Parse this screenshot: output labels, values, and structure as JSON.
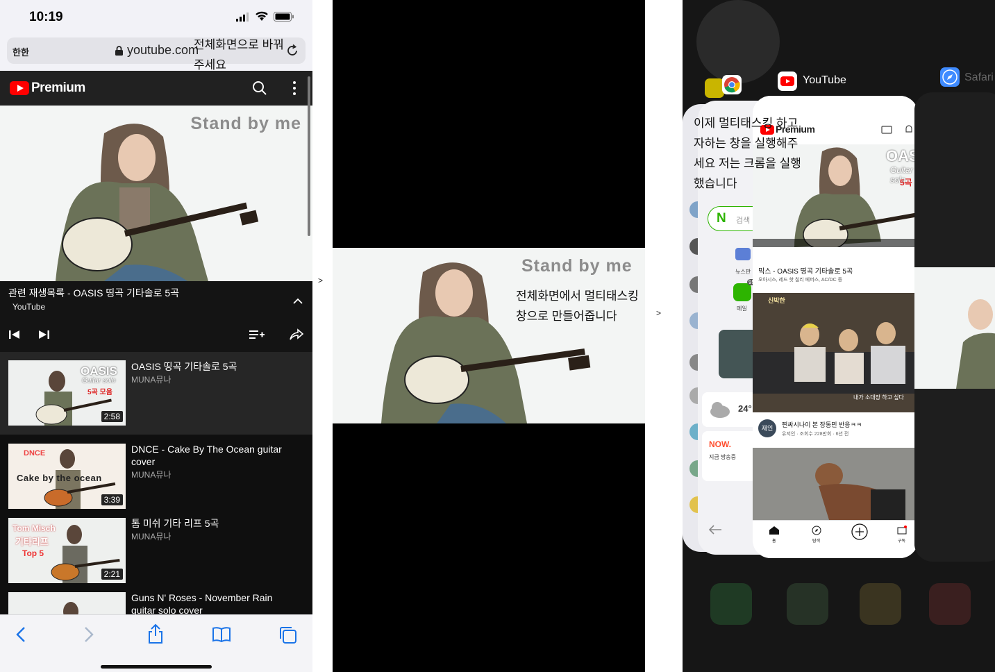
{
  "panel1": {
    "status": {
      "time": "10:19"
    },
    "urlbar": {
      "aa": "한한",
      "domain": "youtube.com"
    },
    "annotation": "전체화면으로 바꿔주세요",
    "header": {
      "brand": "Premium"
    },
    "video": {
      "overlay_title": "Stand by me"
    },
    "playlist": {
      "title": "관련 재생목록 - OASIS 띵곡 기타솔로 5곡",
      "channel": "YouTube"
    },
    "items": [
      {
        "title": "OASIS 띵곡 기타솔로 5곡",
        "channel": "MUNA뮤나",
        "duration": "2:58",
        "thumb_line1": "OASIS",
        "thumb_line2": "Guitar solo",
        "thumb_line3": "5곡 모음"
      },
      {
        "title": "DNCE - Cake By The Ocean guitar cover",
        "channel": "MUNA뮤나",
        "duration": "3:39",
        "thumb_line1": "DNCE",
        "thumb_line2": "Cake by the ocean"
      },
      {
        "title": "톰 미쉬 기타 리프 5곡",
        "channel": "MUNA뮤나",
        "duration": "2:21",
        "thumb_line1": "Tom Misch",
        "thumb_line2": "기타리프",
        "thumb_line3": "Top 5"
      },
      {
        "title": "Guns N' Roses - November Rain guitar solo cover",
        "channel": ""
      }
    ]
  },
  "arrows": {
    "a1": ">",
    "a2": ">"
  },
  "panel2": {
    "overlay_title": "Stand by me",
    "annotation": "전체화면에서 멀티태스킹 창으로 만들어줍니다"
  },
  "panel3": {
    "app_label": "YouTube",
    "safari_label": "Safari",
    "annotation": "이제 멀티태스킹 하고자하는 창을 실행해주세요 저는 크롬을 실행했습니다",
    "card": {
      "brand": "Premium",
      "thumb_title": "OASIS",
      "thumb_sub": "Guitar solo",
      "thumb_count": "5곡",
      "mix_title": "믹스 - OASIS 띵곡 기타솔로 5곡",
      "mix_sub": "오아시스, 레드 핫 칠리 페퍼스, AC/DC 등",
      "tv_badge": "신박한",
      "tv_caption": "내가 소대장 하고 싶다",
      "row2_avatar": "재인",
      "row2_title": "찐싸시나이 본 장동민 반응ㅋㅋ",
      "row2_sub": "유저인 · 조회수 228만회 · 6년 전",
      "tabs": [
        "홈",
        "탐색",
        "",
        "구독"
      ]
    },
    "chrome_card": {
      "search_hint": "검색",
      "temp": "24°",
      "now": "NOW.",
      "now_sub": "지금 방송중",
      "news": "뉴스판",
      "mail": "메일",
      "badge": "95"
    }
  }
}
